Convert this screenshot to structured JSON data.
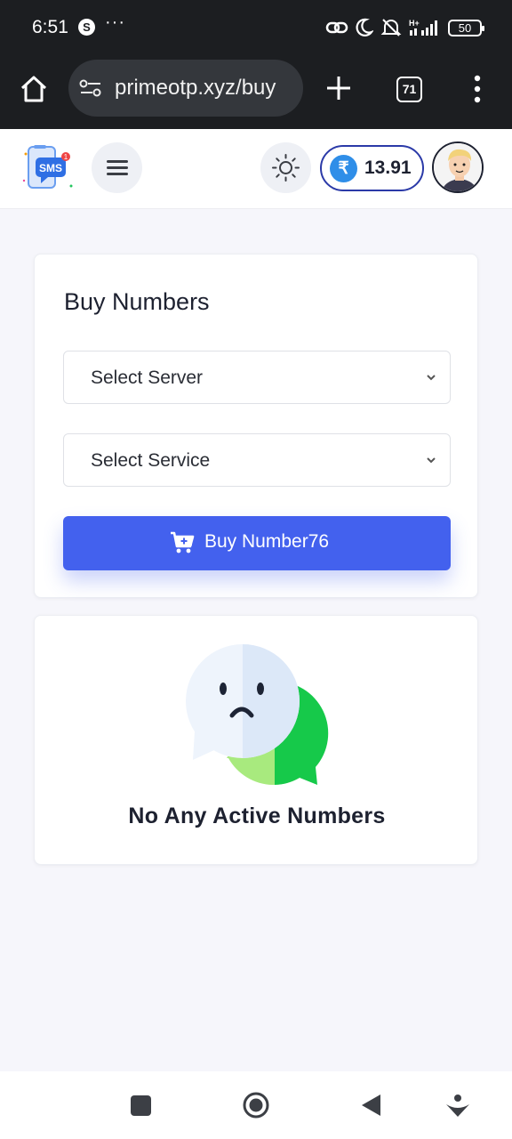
{
  "status_bar": {
    "time": "6:51",
    "app_icon": "S",
    "overflow": "···",
    "battery": "50"
  },
  "browser": {
    "url": "primeotp.xyz/buy",
    "tab_count": "71"
  },
  "header": {
    "logo_text": "SMS",
    "logo_badge": "1",
    "currency_symbol": "₹",
    "balance": "13.91"
  },
  "buy_card": {
    "title": "Buy Numbers",
    "server_placeholder": "Select Server",
    "service_placeholder": "Select Service",
    "buy_button": "Buy Number76"
  },
  "empty_state": {
    "message": "No Any Active Numbers"
  },
  "colors": {
    "primary": "#4361ee",
    "balance_border": "#2b3aa8",
    "rupee": "#2f8ee8",
    "bubble_green": "#22c55e"
  }
}
